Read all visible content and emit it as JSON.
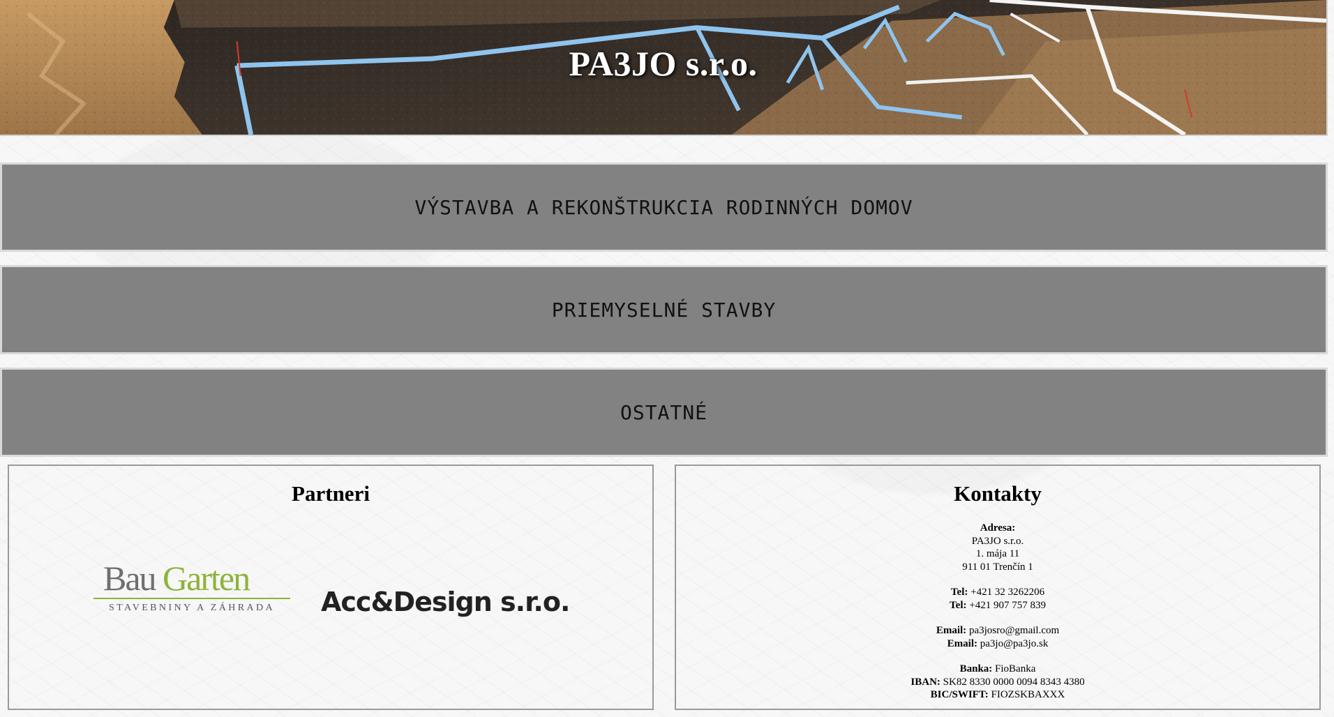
{
  "hero": {
    "title": "PA3JO s.r.o."
  },
  "categories": [
    {
      "label": "VÝSTAVBA A REKONŠTRUKCIA RODINNÝCH DOMOV"
    },
    {
      "label": "PRIEMYSELNÉ STAVBY"
    },
    {
      "label": "OSTATNÉ"
    }
  ],
  "partners": {
    "title": "Partneri",
    "logos": [
      {
        "name_part1": "Bau",
        "name_part2": "Garten",
        "tagline": "STAVEBNINY A ZÁHRADA",
        "accent": "#8db33a"
      },
      {
        "name": "Acc&Design s.r.o."
      }
    ]
  },
  "contacts": {
    "title": "Kontakty",
    "address_label": "Adresa:",
    "address_lines": [
      "PA3JO s.r.o.",
      "1. mája 11",
      "911 01 Trenčín 1"
    ],
    "phones": [
      {
        "label": "Tel:",
        "value": "+421 32 3262206"
      },
      {
        "label": "Tel:",
        "value": "+421 907 757 839"
      }
    ],
    "emails": [
      {
        "label": "Email:",
        "value": "pa3josro@gmail.com"
      },
      {
        "label": "Email:",
        "value": "pa3jo@pa3jo.sk"
      }
    ],
    "bank": [
      {
        "label": "Banka:",
        "value": "FioBanka"
      },
      {
        "label": "IBAN:",
        "value": "SK82 8330 0000 0094 8343 4380"
      },
      {
        "label": "BIC/SWIFT:",
        "value": "FIOZSKBAXXX"
      }
    ]
  },
  "colors": {
    "category_bg": "#828282",
    "category_border": "#d9d9d9",
    "panel_border": "#9a9a9a"
  }
}
